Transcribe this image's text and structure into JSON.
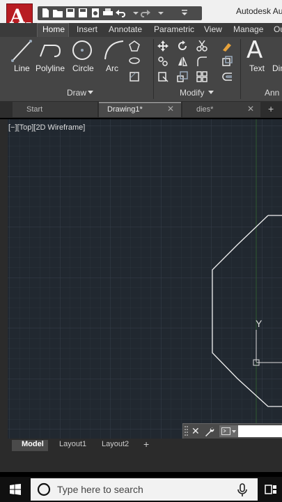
{
  "window": {
    "title": "Autodesk Aut",
    "app_letter": "A"
  },
  "ribbon": {
    "tabs": [
      {
        "id": "home",
        "label": "Home"
      },
      {
        "id": "insert",
        "label": "Insert"
      },
      {
        "id": "annotate",
        "label": "Annotate"
      },
      {
        "id": "parametric",
        "label": "Parametric"
      },
      {
        "id": "view",
        "label": "View"
      },
      {
        "id": "manage",
        "label": "Manage"
      },
      {
        "id": "output",
        "label": "Ou"
      }
    ],
    "draw": {
      "line": "Line",
      "polyline": "Polyline",
      "circle": "Circle",
      "arc": "Arc",
      "panel_title": "Draw"
    },
    "modify": {
      "panel_title": "Modify"
    },
    "annotation": {
      "text": "Text",
      "dim": "Dim",
      "panel_title": "Ann"
    }
  },
  "file_tabs": [
    {
      "id": "start",
      "label": "Start"
    },
    {
      "id": "drawing1",
      "label": "Drawing1*"
    },
    {
      "id": "dies",
      "label": "dies*"
    }
  ],
  "viewport": {
    "label": "[−][Top][2D Wireframe]",
    "ucs_y": "Y"
  },
  "layout_tabs": [
    {
      "id": "model",
      "label": "Model"
    },
    {
      "id": "layout1",
      "label": "Layout1"
    },
    {
      "id": "layout2",
      "label": "Layout2"
    }
  ],
  "taskbar": {
    "search_placeholder": "Type here to search"
  },
  "colors": {
    "canvas": "#212830",
    "accent": "#b81c22"
  }
}
